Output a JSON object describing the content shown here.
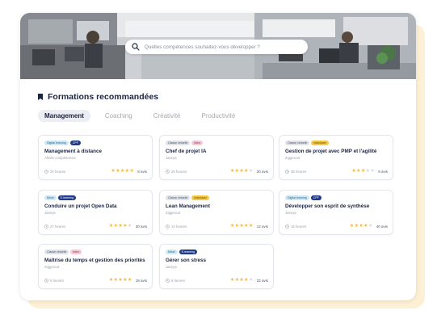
{
  "search": {
    "placeholder": "Quelles compétences souhaitez-vous développer ?"
  },
  "section": {
    "title": "Formations recommandées"
  },
  "tabs": [
    {
      "label": "Management"
    },
    {
      "label": "Coaching"
    },
    {
      "label": "Créativité"
    },
    {
      "label": "Productivité"
    }
  ],
  "colors": {
    "accent_yellow": "#fdf0d4",
    "star": "#f4b63f",
    "text_dark": "#1c2541"
  },
  "cards": [
    {
      "badges": [
        {
          "label": "Digital learning",
          "bg": "#cfe8f4",
          "fg": "#2a6b8a"
        },
        {
          "label": "CPF",
          "bg": "#1f3a8a",
          "fg": "#ffffff"
        }
      ],
      "title": "Management à distance",
      "provider": "Afinité compétences",
      "duration": "20 heures",
      "rating": 5,
      "reviews": "8 avis"
    },
    {
      "badges": [
        {
          "label": "Classe virtuelle",
          "bg": "#dfe2e8",
          "fg": "#4b5563"
        },
        {
          "label": "Intra",
          "bg": "#f3c9d3",
          "fg": "#8a2a47"
        }
      ],
      "title": "Chef de projet IA",
      "provider": "Jaseya",
      "duration": "25 heures",
      "rating": 4,
      "reviews": "20 avis"
    },
    {
      "badges": [
        {
          "label": "Classe virtuelle",
          "bg": "#dfe2e8",
          "fg": "#4b5563"
        },
        {
          "label": "Individuel",
          "bg": "#f7c948",
          "fg": "#5c4308"
        }
      ],
      "title": "Gestion de projet avec PMP et l'agilité",
      "provider": "Ziggeroot",
      "duration": "35 heures",
      "rating": 3,
      "reviews": "9 avis"
    },
    {
      "badges": [
        {
          "label": "Mixte",
          "bg": "#cfe8f4",
          "fg": "#2a6b8a"
        },
        {
          "label": "E-learning",
          "bg": "#1f3a8a",
          "fg": "#ffffff"
        }
      ],
      "title": "Conduire un projet Open Data",
      "provider": "Jaseya",
      "duration": "27 heures",
      "rating": 4,
      "reviews": "30 avis"
    },
    {
      "badges": [
        {
          "label": "Classe virtuelle",
          "bg": "#dfe2e8",
          "fg": "#4b5563"
        },
        {
          "label": "Individuel",
          "bg": "#f7c948",
          "fg": "#5c4308"
        }
      ],
      "title": "Lean Management",
      "provider": "Ziggeroot",
      "duration": "14 heures",
      "rating": 5,
      "reviews": "12 avis"
    },
    {
      "badges": [
        {
          "label": "Digital learning",
          "bg": "#cfe8f4",
          "fg": "#2a6b8a"
        },
        {
          "label": "CPF",
          "bg": "#1f3a8a",
          "fg": "#ffffff"
        }
      ],
      "title": "Développer son esprit de synthèse",
      "provider": "Jaseya",
      "duration": "15 heures",
      "rating": 4,
      "reviews": "40 avis"
    },
    {
      "badges": [
        {
          "label": "Classe virtuelle",
          "bg": "#dfe2e8",
          "fg": "#4b5563"
        },
        {
          "label": "Intra",
          "bg": "#f3c9d3",
          "fg": "#8a2a47"
        }
      ],
      "title": "Maîtrise du temps et gestion des priorités",
      "provider": "Ziggeroot",
      "duration": "9 heures",
      "rating": 5,
      "reviews": "18 avis"
    },
    {
      "badges": [
        {
          "label": "Mixte",
          "bg": "#cfe8f4",
          "fg": "#2a6b8a"
        },
        {
          "label": "E-learning",
          "bg": "#1f3a8a",
          "fg": "#ffffff"
        }
      ],
      "title": "Gérer son stress",
      "provider": "Jaseya",
      "duration": "6 heures",
      "rating": 4,
      "reviews": "22 avis"
    }
  ]
}
